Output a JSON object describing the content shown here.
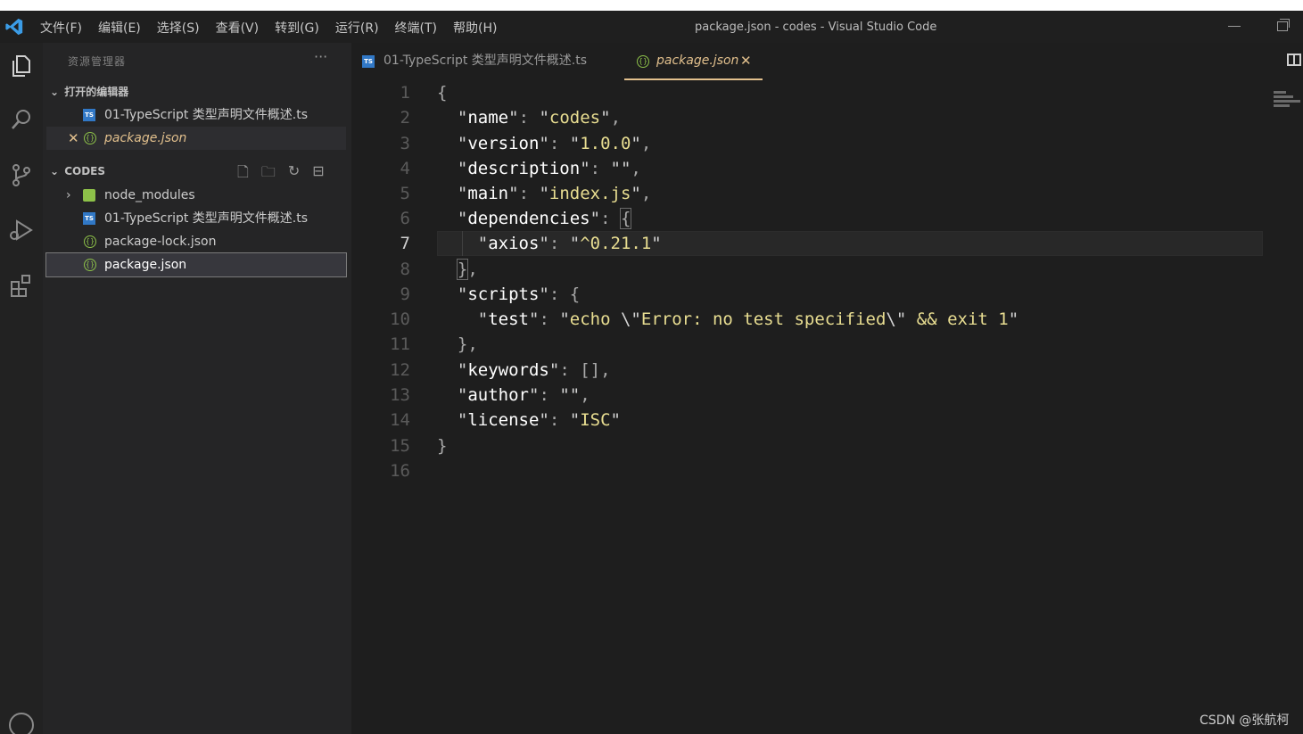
{
  "window": {
    "title": "package.json - codes - Visual Studio Code",
    "menu": [
      "文件(F)",
      "编辑(E)",
      "选择(S)",
      "查看(V)",
      "转到(G)",
      "运行(R)",
      "终端(T)",
      "帮助(H)"
    ]
  },
  "activity_bar": {
    "icons": [
      "explorer-icon",
      "search-icon",
      "source-control-icon",
      "run-debug-icon",
      "extensions-icon",
      "account-icon"
    ]
  },
  "sidebar": {
    "title": "资源管理器",
    "more": "···",
    "open_editors": {
      "header": "打开的编辑器",
      "items": [
        {
          "label": "01-TypeScript 类型声明文件概述.ts",
          "type": "ts"
        },
        {
          "label": "package.json",
          "type": "json",
          "close": "✕"
        }
      ]
    },
    "codes": {
      "header": "CODES",
      "items": [
        {
          "label": "node_modules",
          "type": "folder",
          "chevron": "›"
        },
        {
          "label": "01-TypeScript 类型声明文件概述.ts",
          "type": "ts"
        },
        {
          "label": "package-lock.json",
          "type": "json"
        },
        {
          "label": "package.json",
          "type": "json"
        }
      ]
    }
  },
  "tabs": [
    {
      "label": "01-TypeScript 类型声明文件概述.ts",
      "active": false
    },
    {
      "label": "package.json",
      "active": true,
      "close": "✕"
    }
  ],
  "editor": {
    "current_line": 7,
    "line_numbers": [
      "1",
      "2",
      "3",
      "4",
      "5",
      "6",
      "7",
      "8",
      "9",
      "10",
      "11",
      "12",
      "13",
      "14",
      "15",
      "16"
    ]
  },
  "colors": {
    "accent": "#e2c08d",
    "string": "#e8dd91",
    "ts_icon": "#3178c6",
    "json_icon": "#8dc149"
  },
  "watermark": "CSDN @张航柯"
}
